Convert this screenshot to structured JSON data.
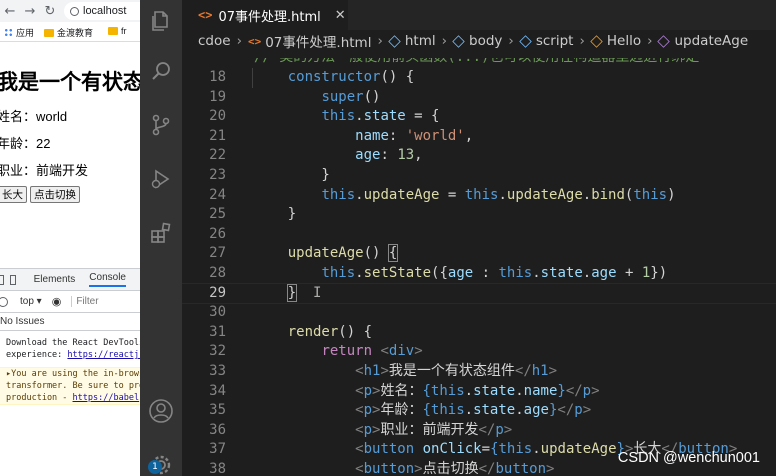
{
  "browser": {
    "url": "localhost",
    "bookmarks": [
      "应用",
      "金渡教育",
      "fr"
    ],
    "page": {
      "heading": "我是一个有状态组件",
      "name_line": "姓名：world",
      "age_line": "年龄：22",
      "job_line": "职业：前端开发",
      "btn_grow": "长大",
      "btn_toggle": "点击切换"
    },
    "devtools": {
      "tab_elements": "Elements",
      "tab_console": "Console",
      "context": "top ▾",
      "filter_placeholder": "Filter",
      "issues": "No Issues",
      "msg1_line1": "Download the React DevTools for a better development",
      "msg1_line2": "experience: ",
      "msg1_link": "https://reactjs.org/link/react-devtools",
      "warn_line1": "▸You are using the in-browser Babel",
      "warn_line2": "transformer. Be sure to precompile your scripts for",
      "warn_line3": "production - ",
      "warn_link": "https://babeljs.io/docs/setup/"
    }
  },
  "editor": {
    "tab_label": "07事件处理.html",
    "tab_icon": "<>",
    "breadcrumb": {
      "folder": "cdoe",
      "file": "07事件处理.html",
      "html": "html",
      "body": "body",
      "script": "script",
      "class": "Hello",
      "method": "updateAge"
    },
    "scroll_top_fragment": "// 类的方法一般使用箭头函数(...)也可以使用在构造器里边进行绑定",
    "line_numbers": [
      "18",
      "19",
      "20",
      "21",
      "22",
      "23",
      "24",
      "25",
      "26",
      "27",
      "28",
      "29",
      "30",
      "31",
      "32",
      "33",
      "34",
      "35",
      "36",
      "37",
      "38"
    ],
    "current_line": "29",
    "badge": "1"
  },
  "watermark": "CSDN @wenchun001",
  "icons": {
    "explorer": "files-icon",
    "search": "search-icon",
    "scm": "source-control-icon",
    "debug": "run-debug-icon",
    "extensions": "extensions-icon",
    "account": "account-icon",
    "settings": "gear-icon"
  }
}
